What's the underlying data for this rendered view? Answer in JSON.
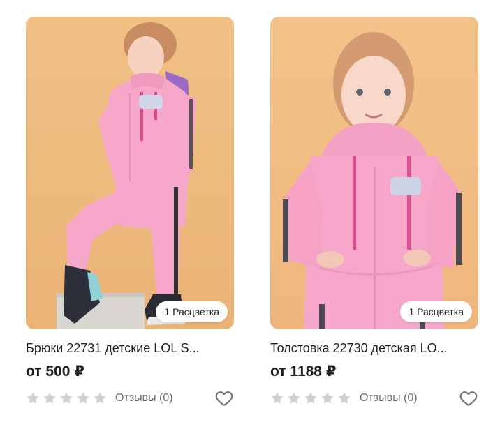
{
  "products": [
    {
      "badge": "1 Расцветка",
      "title": "Брюки 22731 детские LOL S...",
      "price": "от 500 ₽",
      "reviews": "Отзывы (0)",
      "rating": 0,
      "icons": [
        "star-icon",
        "heart-icon"
      ]
    },
    {
      "badge": "1 Расцветка",
      "title": "Толстовка 22730 детская LO...",
      "price": "от 1188 ₽",
      "reviews": "Отзывы (0)",
      "rating": 0,
      "icons": [
        "star-icon",
        "heart-icon"
      ]
    }
  ],
  "colors": {
    "background_photo": "#f3bf86",
    "tracksuit_pink": "#f4a4c8",
    "star_empty": "#d0d0d0",
    "heart_outline": "#707070"
  }
}
